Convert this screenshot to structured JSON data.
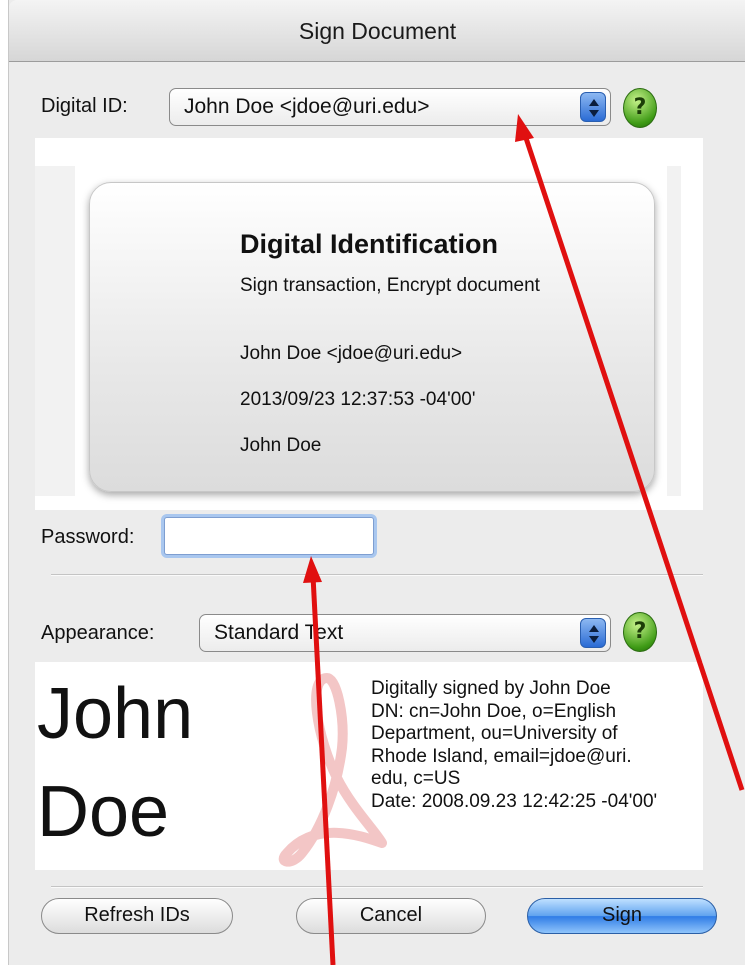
{
  "window": {
    "title": "Sign Document"
  },
  "digital_id": {
    "label": "Digital ID:",
    "selected": "John Doe <jdoe@uri.edu>",
    "help_icon": "?"
  },
  "id_card": {
    "title": "Digital Identification",
    "usage": "Sign transaction, Encrypt document",
    "name_email": "John Doe <jdoe@uri.edu>",
    "datetime": "2013/09/23 12:37:53 -04'00'",
    "name": "John Doe"
  },
  "password": {
    "label": "Password:",
    "value": ""
  },
  "appearance": {
    "label": "Appearance:",
    "selected": "Standard Text",
    "help_icon": "?",
    "preview_name_line1": "John",
    "preview_name_line2": "Doe",
    "details": [
      "Digitally signed by John Doe",
      "DN: cn=John Doe, o=English",
      "Department, ou=University of",
      "Rhode Island, email=jdoe@uri.",
      "edu, c=US",
      "Date: 2008.09.23 12:42:25 -04'00'"
    ]
  },
  "buttons": {
    "refresh": "Refresh IDs",
    "cancel": "Cancel",
    "sign": "Sign"
  },
  "colors": {
    "annotation_arrow": "#e01010",
    "primary_button": "#2f7ce6",
    "help_icon": "#3f9b16"
  }
}
